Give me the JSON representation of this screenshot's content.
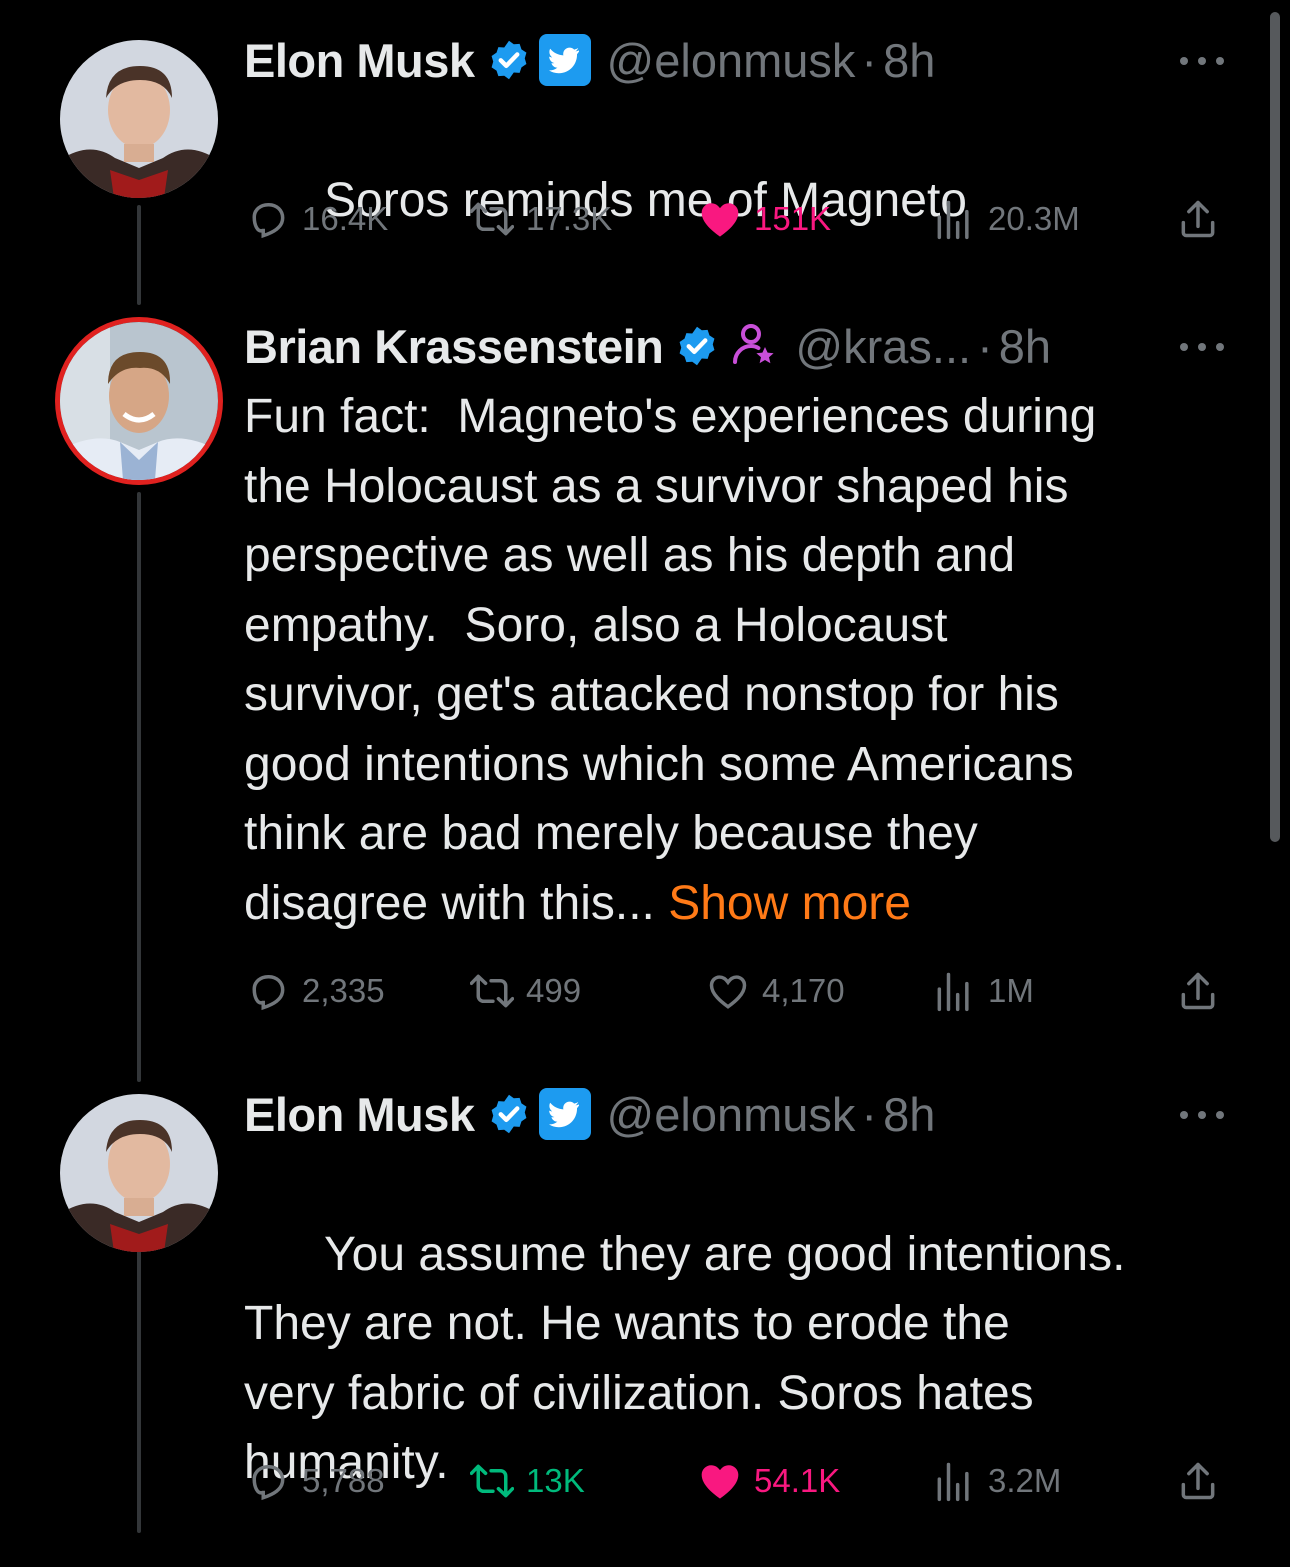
{
  "tweets": [
    {
      "name": "Elon Musk",
      "handle": "@elonmusk",
      "time": "8h",
      "text": "Soros reminds me of Magneto",
      "show_more": "",
      "replies": "16.4K",
      "retweets": "17.3K",
      "likes": "151K",
      "views": "20.3M",
      "liked": true,
      "retweeted": false,
      "badges": [
        "verified-check-icon",
        "twitter-bird-icon"
      ]
    },
    {
      "name": "Brian Krassenstein",
      "handle": "@kras...",
      "time": "8h",
      "text": "Fun fact:  Magneto's experiences during\nthe Holocaust as a survivor shaped his\nperspective as well as his depth and\nempathy.  Soro, also a Holocaust\nsurvivor, get's attacked nonstop for his\ngood intentions which some Americans\nthink are bad merely because they\ndisagree with this...",
      "show_more": "Show more",
      "replies": "2,335",
      "retweets": "499",
      "likes": "4,170",
      "views": "1M",
      "liked": false,
      "retweeted": false,
      "badges": [
        "verified-check-icon",
        "subscriber-person-star-icon"
      ]
    },
    {
      "name": "Elon Musk",
      "handle": "@elonmusk",
      "time": "8h",
      "text": "You assume they are good intentions.\nThey are not. He wants to erode the\nvery fabric of civilization. Soros hates\nhumanity.",
      "show_more": "",
      "replies": "5,788",
      "retweets": "13K",
      "likes": "54.1K",
      "views": "3.2M",
      "liked": true,
      "retweeted": true,
      "badges": [
        "verified-check-icon",
        "twitter-bird-icon"
      ]
    }
  ],
  "separator": "·",
  "colors": {
    "background": "#000000",
    "text": "#e7e9ea",
    "muted": "#71767b",
    "verified": "#1d9bf0",
    "like": "#f91880",
    "retweet": "#00ba7c",
    "show_more": "#ff7a17",
    "avatar_ring": "#e0211f"
  }
}
